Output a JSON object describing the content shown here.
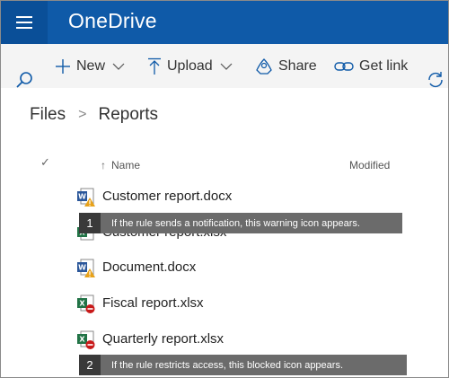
{
  "app": {
    "title": "OneDrive"
  },
  "commandbar": {
    "search_icon": "search-icon",
    "new_label": "New",
    "upload_label": "Upload",
    "share_label": "Share",
    "getlink_label": "Get link"
  },
  "breadcrumb": {
    "root": "Files",
    "separator": ">",
    "current": "Reports"
  },
  "list": {
    "columns": {
      "name": "Name",
      "modified": "Modified"
    },
    "files": [
      {
        "name": "Customer report.docx",
        "type": "word",
        "badge": "warning"
      },
      {
        "name": "Customer report.xlsx",
        "type": "excel",
        "badge": "none"
      },
      {
        "name": "Document.docx",
        "type": "word",
        "badge": "warning"
      },
      {
        "name": "Fiscal report.xlsx",
        "type": "excel",
        "badge": "blocked"
      },
      {
        "name": "Quarterly report.xlsx",
        "type": "excel",
        "badge": "blocked"
      }
    ]
  },
  "callouts": [
    {
      "number": "1",
      "text": "If the rule sends a notification, this warning icon appears."
    },
    {
      "number": "2",
      "text": "If the rule restricts access, this blocked icon appears."
    }
  ],
  "colors": {
    "suitebar": "#0f5aa8",
    "word": "#2b579a",
    "excel": "#217346",
    "warning": "#e8a21a",
    "blocked": "#c81919"
  }
}
